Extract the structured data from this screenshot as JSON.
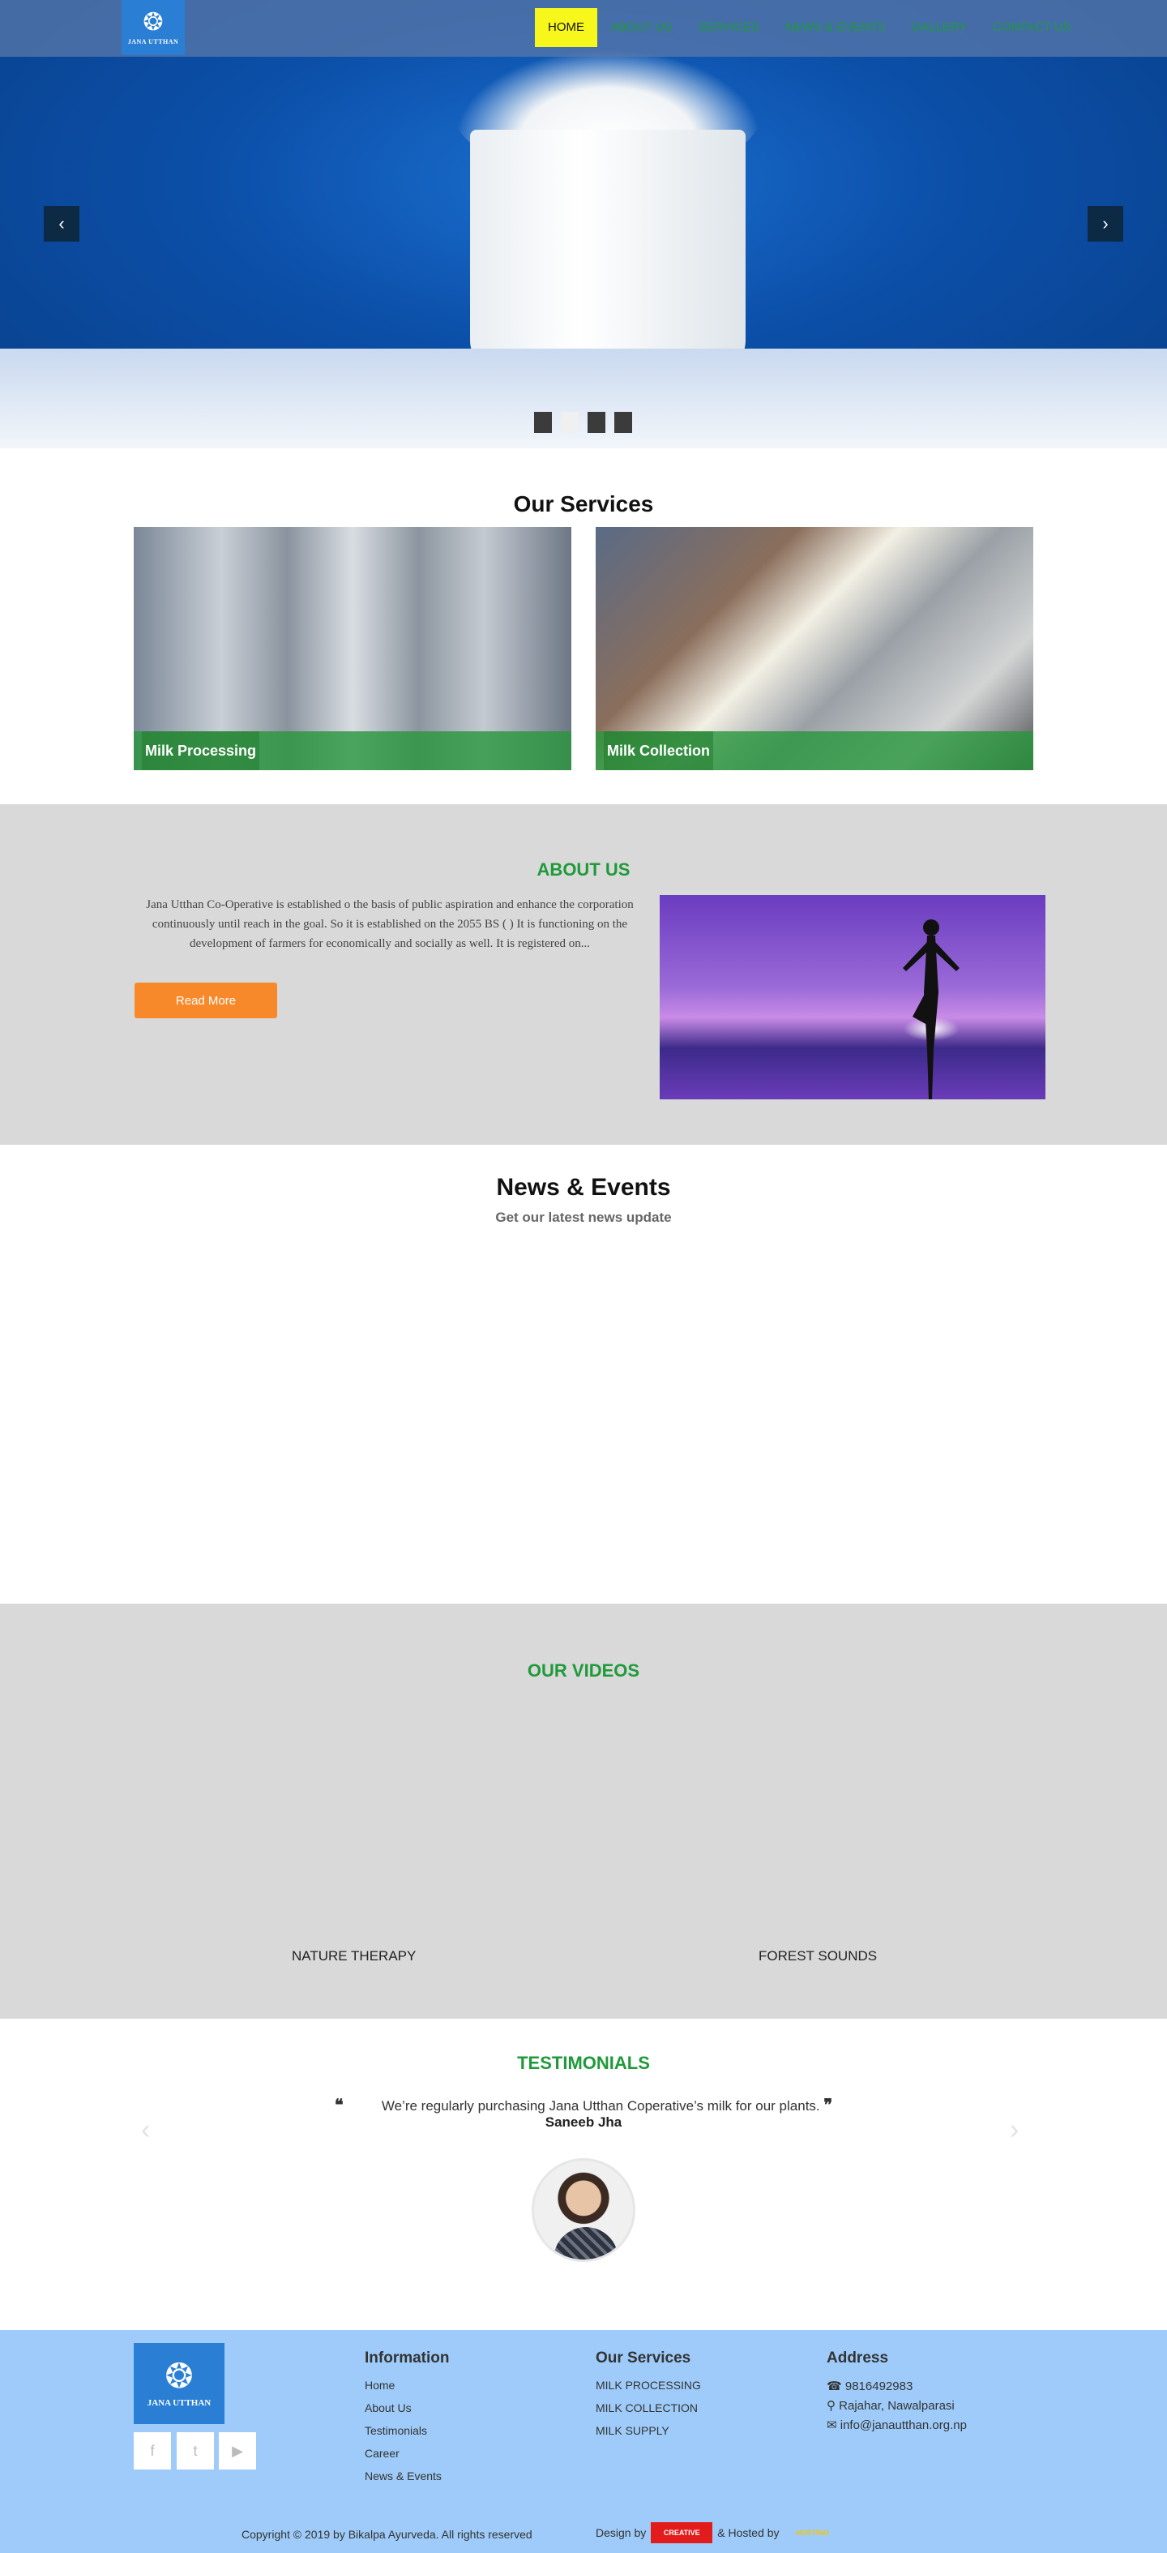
{
  "header": {
    "logo_text": "JANA UTTHAN",
    "nav": [
      "HOME",
      "ABOUT US",
      "SERVICES",
      "NEWS & EVENTS",
      "GALLERY",
      "CONTACT US"
    ]
  },
  "hero": {
    "prev_icon": "‹",
    "next_icon": "›"
  },
  "services": {
    "title": "Our Services",
    "items": [
      {
        "caption": "Milk Processing"
      },
      {
        "caption": "Milk Collection"
      }
    ]
  },
  "about": {
    "title": "ABOUT US",
    "text": "Jana Utthan Co-Operative is established o the basis of public aspiration and enhance the corporation continuously until reach in the goal. So it is established on the 2055 BS ( ) It is functioning on the development of farmers for economically and socially as well. It is registered on...",
    "button": "Read More"
  },
  "news": {
    "title": "News & Events",
    "subtitle": "Get our latest news update"
  },
  "videos": {
    "title": "OUR VIDEOS",
    "items": [
      {
        "label": "NATURE THERAPY"
      },
      {
        "label": "FOREST SOUNDS"
      }
    ]
  },
  "testimonials": {
    "title": "TESTIMONIALS",
    "quote": "We’re regularly purchasing Jana Utthan Coperative’s milk for our plants.",
    "name": "Saneeb Jha",
    "open_quote": "❝",
    "close_quote": "❞",
    "prev": "‹",
    "next": "›"
  },
  "footer": {
    "logo_text": "JANA UTTHAN",
    "social": [
      "f",
      "t",
      "▶"
    ],
    "information": {
      "title": "Information",
      "links": [
        "Home",
        "About Us",
        "Testimonials",
        "Career",
        "News & Events"
      ]
    },
    "our_services": {
      "title": "Our Services",
      "links": [
        "MILK PROCESSING",
        "MILK COLLECTION",
        "MILK SUPPLY"
      ]
    },
    "address": {
      "title": "Address",
      "phone": "9816492983",
      "location": "Rajahar, Nawalparasi",
      "email": "info@janautthan.org.np"
    },
    "copyright": "Copyright © 2019 by Bikalpa Ayurveda. All rights reserved",
    "design_by": "Design by",
    "design_badge": "CREATIVE",
    "hosted_by": "& Hosted by",
    "hosted_badge": "HOSTING"
  }
}
